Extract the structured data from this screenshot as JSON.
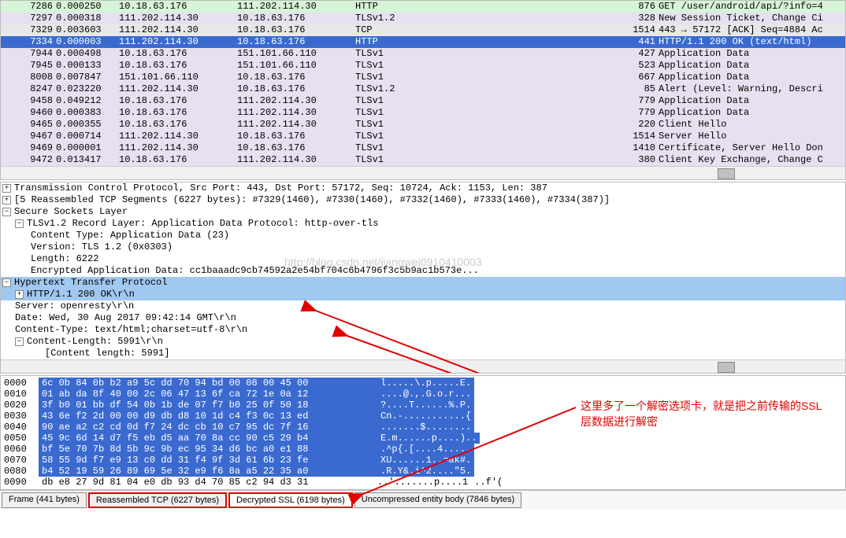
{
  "packets": [
    {
      "no": "7286",
      "time": "0.000250",
      "src": "10.18.63.176",
      "dst": "111.202.114.30",
      "proto": "HTTP",
      "len": "876",
      "info": "GET /user/android/api/?info=4",
      "cls": "row-http-green"
    },
    {
      "no": "7297",
      "time": "0.000318",
      "src": "111.202.114.30",
      "dst": "10.18.63.176",
      "proto": "TLSv1.2",
      "len": "328",
      "info": "New Session Ticket, Change Ci",
      "cls": "row-tls-purple"
    },
    {
      "no": "7329",
      "time": "0.003603",
      "src": "111.202.114.30",
      "dst": "10.18.63.176",
      "proto": "TCP",
      "len": "1514",
      "info": "443 → 57172 [ACK] Seq=4884 Ac",
      "cls": "row-tcp-gray"
    },
    {
      "no": "7334",
      "time": "0.000003",
      "src": "111.202.114.30",
      "dst": "10.18.63.176",
      "proto": "HTTP",
      "len": "441",
      "info": "HTTP/1.1 200 OK  (text/html)",
      "cls": "row-selected"
    },
    {
      "no": "7944",
      "time": "0.000498",
      "src": "10.18.63.176",
      "dst": "151.101.66.110",
      "proto": "TLSv1",
      "len": "427",
      "info": "Application Data",
      "cls": "row-tls-purple"
    },
    {
      "no": "7945",
      "time": "0.000133",
      "src": "10.18.63.176",
      "dst": "151.101.66.110",
      "proto": "TLSv1",
      "len": "523",
      "info": "Application Data",
      "cls": "row-tls-purple"
    },
    {
      "no": "8008",
      "time": "0.007847",
      "src": "151.101.66.110",
      "dst": "10.18.63.176",
      "proto": "TLSv1",
      "len": "667",
      "info": "Application Data",
      "cls": "row-tls-purple"
    },
    {
      "no": "8247",
      "time": "0.023220",
      "src": "111.202.114.30",
      "dst": "10.18.63.176",
      "proto": "TLSv1.2",
      "len": "85",
      "info": "Alert (Level: Warning, Descri",
      "cls": "row-tls-purple"
    },
    {
      "no": "9458",
      "time": "0.049212",
      "src": "10.18.63.176",
      "dst": "111.202.114.30",
      "proto": "TLSv1",
      "len": "779",
      "info": "Application Data",
      "cls": "row-tls-purple"
    },
    {
      "no": "9460",
      "time": "0.000383",
      "src": "10.18.63.176",
      "dst": "111.202.114.30",
      "proto": "TLSv1",
      "len": "779",
      "info": "Application Data",
      "cls": "row-tls-purple"
    },
    {
      "no": "9465",
      "time": "0.000355",
      "src": "10.18.63.176",
      "dst": "111.202.114.30",
      "proto": "TLSv1",
      "len": "220",
      "info": "Client Hello",
      "cls": "row-tls-purple"
    },
    {
      "no": "9467",
      "time": "0.000714",
      "src": "111.202.114.30",
      "dst": "10.18.63.176",
      "proto": "TLSv1",
      "len": "1514",
      "info": "Server Hello",
      "cls": "row-tls-purple"
    },
    {
      "no": "9469",
      "time": "0.000001",
      "src": "111.202.114.30",
      "dst": "10.18.63.176",
      "proto": "TLSv1",
      "len": "1410",
      "info": "Certificate, Server Hello Don",
      "cls": "row-tls-purple"
    },
    {
      "no": "9472",
      "time": "0.013417",
      "src": "10.18.63.176",
      "dst": "111.202.114.30",
      "proto": "TLSv1",
      "len": "380",
      "info": "Client Key Exchange, Change C",
      "cls": "row-tls-purple"
    }
  ],
  "details": {
    "tcp": "Transmission Control Protocol, Src Port: 443, Dst Port: 57172, Seq: 10724, Ack: 1153, Len: 387",
    "reassembled": "[5 Reassembled TCP Segments (6227 bytes): #7329(1460), #7330(1460), #7332(1460), #7333(1460), #7334(387)]",
    "ssl": "Secure Sockets Layer",
    "record": "TLSv1.2 Record Layer: Application Data Protocol: http-over-tls",
    "contentType": "Content Type: Application Data (23)",
    "version": "Version: TLS 1.2 (0x0303)",
    "length": "Length: 6222",
    "encrypted": "Encrypted Application Data: cc1baaadc9cb74592a2e54bf704c6b4796f3c5b9ac1b573e...",
    "http": "Hypertext Transfer Protocol",
    "httpStatus": "HTTP/1.1 200 OK\\r\\n",
    "server": "Server: openresty\\r\\n",
    "date": "Date: Wed, 30 Aug 2017 09:42:14 GMT\\r\\n",
    "ctype": "Content-Type: text/html;charset=utf-8\\r\\n",
    "clen": "Content-Length: 5991\\r\\n",
    "clenVal": "[Content length: 5991]"
  },
  "watermark": "http://blog.csdn.net/jiangwei0910410003",
  "hex": [
    {
      "off": "0000",
      "b": "6c 0b 84 0b b2 a9 5c dd  70 94 bd 00 08 00 45 00",
      "a": "l.....\\.p.....E."
    },
    {
      "off": "0010",
      "b": "01 ab da 8f 40 00 2c 06  47 13 6f ca 72 1e 0a 12",
      "a": "....@.,.G.o.r..."
    },
    {
      "off": "0020",
      "b": "3f b0 01 bb df 54 0b 1b  de 07 f7 b0 25 0f 50 18",
      "a": "?....T......%.P."
    },
    {
      "off": "0030",
      "b": "43 6e f2 2d 00 00 d9 db  d8 10 1d c4 f3 0c 13 ed",
      "a": "Cn.-...........{"
    },
    {
      "off": "0040",
      "b": "90 ae a2 c2 cd 0d f7 24  dc cb 10 c7 95 dc 7f 16",
      "a": ".......$........"
    },
    {
      "off": "0050",
      "b": "45 9c 6d 14 d7 f5 eb d5  aa 70 8a cc 90 c5 29 b4",
      "a": "E.m......p....).."
    },
    {
      "off": "0060",
      "b": "bf 5e 70 7b 8d 5b 9c 9b  ec 95 34 d6 bc a0 e1 88",
      "a": ".^p{.[....4....."
    },
    {
      "off": "0070",
      "b": "58 55 9d f7 e9 13 c0 dd  31 f4 9f 3d 61 6b 23 fe",
      "a": "XU......1..=ak#."
    },
    {
      "off": "0080",
      "b": "b4 52 19 59 26 89 69 5e  32 e9 f6 8a a5 22 35 a0",
      "a": ".R.Y&.i^2....\"5."
    },
    {
      "off": "0090",
      "b": "db e8 27 9d 81 04 e0 db  93 d4 70 85 c2 94 d3 31",
      "a": "..'.......p....1"
    }
  ],
  "hexAsciiSuffix": "..f'(",
  "tabs": {
    "frame": "Frame (441 bytes)",
    "reassembled": "Reassembled TCP (6227 bytes)",
    "decrypted": "Decrypted SSL (6198 bytes)",
    "uncompressed": "Uncompressed entity body (7846 bytes)"
  },
  "annotation": "这里多了一个解密选项卡，就是把之前传输的SSL层数据进行解密"
}
